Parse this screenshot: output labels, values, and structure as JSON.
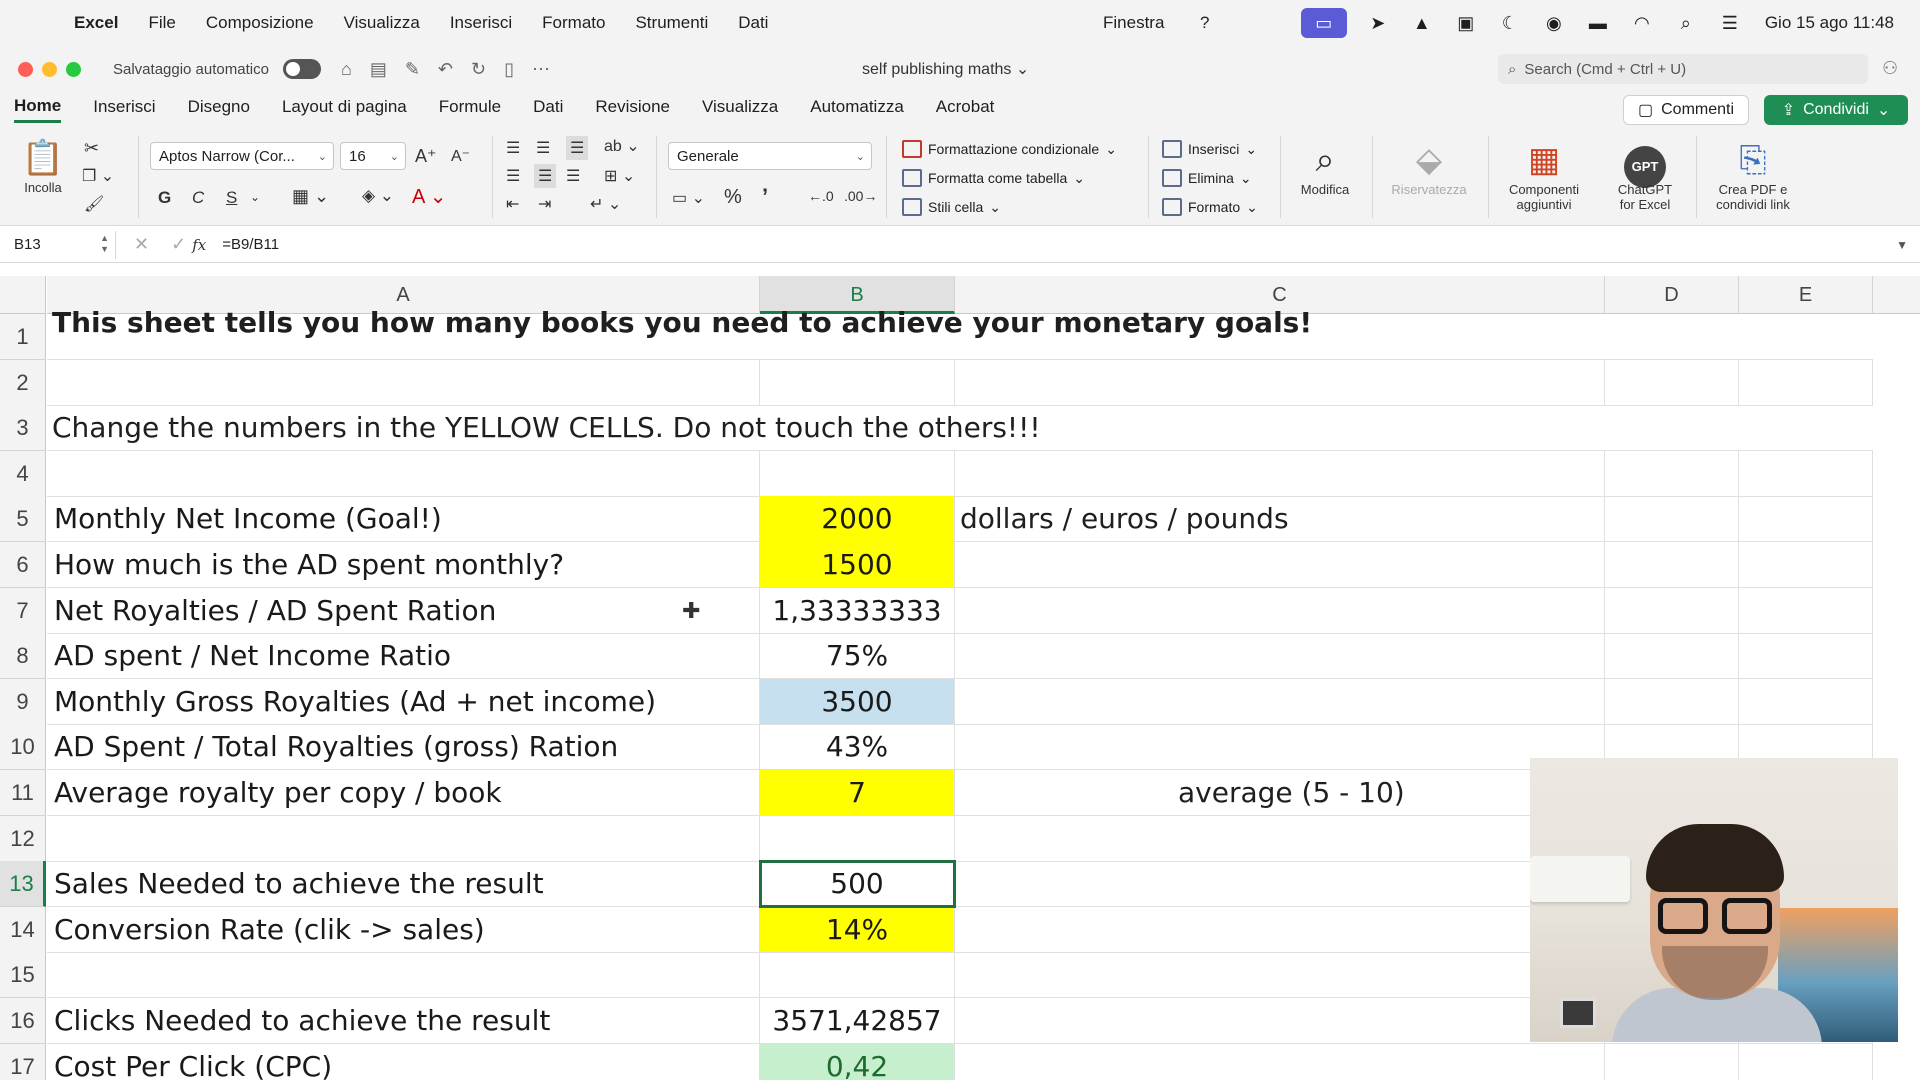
{
  "menubar": {
    "app_name": "Excel",
    "items": [
      "File",
      "Composizione",
      "Visualizza",
      "Inserisci",
      "Formato",
      "Strumenti",
      "Dati"
    ],
    "window_menu": "Finestra",
    "help_menu": "?",
    "clock": "Gio 15 ago  11:48"
  },
  "titlebar": {
    "autosave_label": "Salvataggio automatico",
    "document_title": "self publishing maths",
    "search_placeholder": "Search (Cmd + Ctrl + U)"
  },
  "ribbon_tabs": [
    "Home",
    "Inserisci",
    "Disegno",
    "Layout di pagina",
    "Formule",
    "Dati",
    "Revisione",
    "Visualizza",
    "Automatizza",
    "Acrobat"
  ],
  "ribbon_actions": {
    "comments": "Commenti",
    "share": "Condividi"
  },
  "ribbon": {
    "paste_label": "Incolla",
    "font_name": "Aptos Narrow (Cor...",
    "font_size": "16",
    "number_format": "Generale",
    "bold": "G",
    "italic": "C",
    "underline": "S",
    "percent": "%",
    "comma": "’",
    "conditional_formatting": "Formattazione condizionale",
    "format_as_table": "Formatta come tabella",
    "cell_styles": "Stili cella",
    "insert": "Inserisci",
    "delete": "Elimina",
    "format": "Formato",
    "edit": "Modifica",
    "privacy": "Riservatezza",
    "addins_line1": "Componenti",
    "addins_line2": "aggiuntivi",
    "gpt_badge": "GPT",
    "chatgpt_line1": "ChatGPT",
    "chatgpt_line2": "for Excel",
    "pdf_line1": "Crea PDF e",
    "pdf_line2": "condividi link"
  },
  "formula_bar": {
    "name_box": "B13",
    "fx": "fx",
    "formula": "=B9/B11"
  },
  "columns": [
    "A",
    "B",
    "C",
    "D",
    "E"
  ],
  "selected_column": "B",
  "selected_row": "13",
  "rows": [
    {
      "num": "1",
      "a": "This sheet tells you how many books you need to achieve your monetary goals!",
      "b": "",
      "c": ""
    },
    {
      "num": "2",
      "a": "",
      "b": "",
      "c": ""
    },
    {
      "num": "3",
      "a": "Change the numbers in the YELLOW CELLS. Do not touch the others!!!",
      "b": "",
      "c": ""
    },
    {
      "num": "4",
      "a": "",
      "b": "",
      "c": ""
    },
    {
      "num": "5",
      "a": "Monthly Net Income (Goal!)",
      "b": "2000",
      "c": "dollars / euros / pounds",
      "fill": "yellow"
    },
    {
      "num": "6",
      "a": "How much is the AD spent monthly?",
      "b": "1500",
      "c": "",
      "fill": "yellow"
    },
    {
      "num": "7",
      "a": "Net Royalties / AD Spent Ration",
      "b": "1,33333333",
      "c": ""
    },
    {
      "num": "8",
      "a": "AD spent / Net Income Ratio",
      "b": "75%",
      "c": ""
    },
    {
      "num": "9",
      "a": "Monthly Gross Royalties (Ad + net income)",
      "b": "3500",
      "c": "",
      "fill": "blue"
    },
    {
      "num": "10",
      "a": "AD Spent / Total Royalties (gross) Ration",
      "b": "43%",
      "c": ""
    },
    {
      "num": "11",
      "a": "Average royalty per copy / book",
      "b": "7",
      "c": "average (5 - 10)",
      "fill": "yellow"
    },
    {
      "num": "12",
      "a": "",
      "b": "",
      "c": ""
    },
    {
      "num": "13",
      "a": "Sales Needed to achieve the result",
      "b": "500",
      "c": "",
      "active": true
    },
    {
      "num": "14",
      "a": "Conversion Rate (clik -> sales)",
      "b": "14%",
      "c": "",
      "fill": "yellow"
    },
    {
      "num": "15",
      "a": "",
      "b": "",
      "c": ""
    },
    {
      "num": "16",
      "a": "Clicks Needed to achieve the result",
      "b": "3571,42857",
      "c": ""
    },
    {
      "num": "17",
      "a": "Cost Per Click (CPC)",
      "b": "0,42",
      "c": "",
      "fill": "green"
    }
  ]
}
